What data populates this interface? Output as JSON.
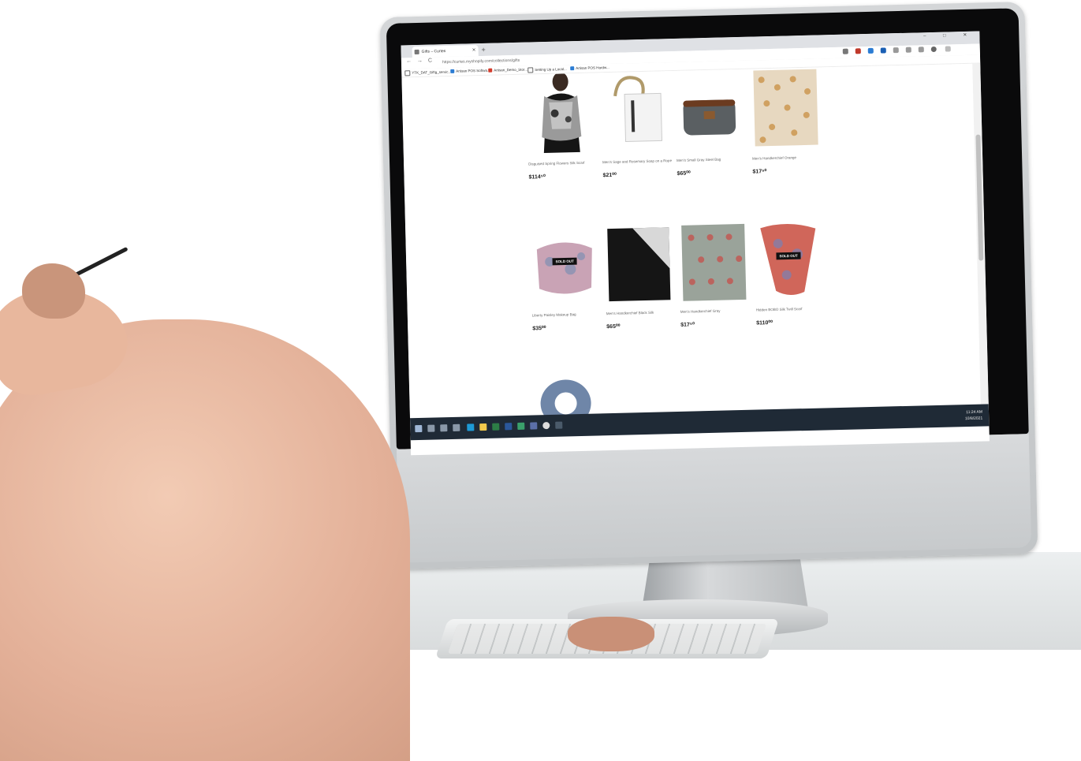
{
  "browser": {
    "tab_title": "Gifts – Curtes",
    "new_tab_symbol": "+",
    "window_controls": "– □ ✕",
    "back": "←",
    "forward": "→",
    "reload": "C",
    "url": "https://curtes.myshopify.com/collections/gifts",
    "bookmarks": [
      {
        "label": "YTK_DAT_Giftg_servic...",
        "color": "#ffffff"
      },
      {
        "label": "Artisan POS Softwa...",
        "color": "#2b7cd3"
      },
      {
        "label": "Artisan_Demo_Stor...",
        "color": "#d33b2b"
      },
      {
        "label": "Setting Up a Local...",
        "color": "#ffffff"
      },
      {
        "label": "Artisan POS Hardw...",
        "color": "#2b7cd3"
      }
    ]
  },
  "products": [
    {
      "title": "Disguised Spring Flowers Silk Scarf",
      "price": "$114⁵⁰",
      "sold_out": ""
    },
    {
      "title": "Men's Sage and Rosemary Soap on a Rope",
      "price": "$21⁰⁰",
      "sold_out": ""
    },
    {
      "title": "Men's Small Gray Steel Bag",
      "price": "$65⁰⁰",
      "sold_out": ""
    },
    {
      "title": "Men's Handkerchief Orange",
      "price": "$17⁵⁰",
      "sold_out": ""
    },
    {
      "title": "Liberty Paisley Makeup Bag",
      "price": "$35⁰⁰",
      "sold_out": "SOLD OUT"
    },
    {
      "title": "Men's Handkerchief Black Silk",
      "price": "$65⁰⁰",
      "sold_out": ""
    },
    {
      "title": "Men's Handkerchief Gray",
      "price": "$17⁵⁰",
      "sold_out": ""
    },
    {
      "title": "Hidden BOBO Silk Twill Scarf",
      "price": "$110⁰⁰",
      "sold_out": "SOLD OUT"
    }
  ],
  "taskbar": {
    "time": "11:24 AM",
    "date": "10/8/2021"
  },
  "colors": {
    "taskbar": "#1f2a36",
    "tab_strip": "#dfe1e5",
    "sold_out_badge": "#111111",
    "skin": "#e8b79d"
  }
}
